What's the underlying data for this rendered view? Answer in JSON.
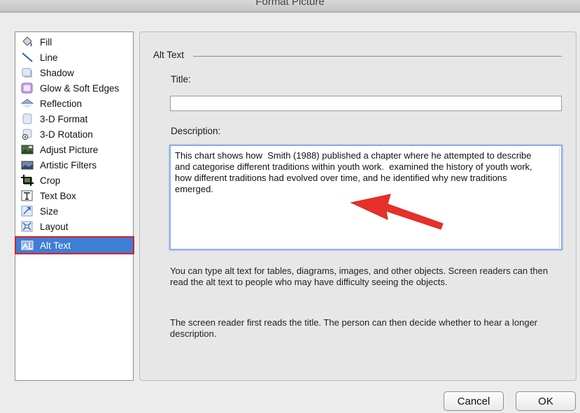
{
  "window": {
    "title": "Format Picture"
  },
  "sidebar": {
    "items": [
      {
        "label": "Fill",
        "icon": "paint-bucket-icon"
      },
      {
        "label": "Line",
        "icon": "line-icon"
      },
      {
        "label": "Shadow",
        "icon": "shadow-icon"
      },
      {
        "label": "Glow & Soft Edges",
        "icon": "glow-icon"
      },
      {
        "label": "Reflection",
        "icon": "reflection-icon"
      },
      {
        "label": "3-D Format",
        "icon": "3d-format-icon"
      },
      {
        "label": "3-D Rotation",
        "icon": "3d-rotation-icon"
      },
      {
        "label": "Adjust Picture",
        "icon": "adjust-picture-icon"
      },
      {
        "label": "Artistic Filters",
        "icon": "artistic-filters-icon"
      },
      {
        "label": "Crop",
        "icon": "crop-icon"
      },
      {
        "label": "Text Box",
        "icon": "text-box-icon"
      },
      {
        "label": "Size",
        "icon": "size-icon"
      },
      {
        "label": "Layout",
        "icon": "layout-icon"
      },
      {
        "label": "Alt Text",
        "icon": "alt-text-icon",
        "selected": true
      }
    ]
  },
  "panel": {
    "section_title": "Alt Text",
    "title_label": "Title:",
    "title_value": "",
    "description_label": "Description:",
    "description_value": "This chart shows how  Smith (1988) published a chapter where he attempted to describe and categorise different traditions within youth work.  examined the history of youth work, how different traditions had evolved over time, and he identified why new traditions emerged.",
    "help_text_1": "You can type alt text for tables, diagrams, images, and other objects. Screen readers can then read the alt text to people who may have difficulty seeing the objects.",
    "help_text_2": "The screen reader first reads the title. The person can then decide whether to hear a longer description."
  },
  "buttons": {
    "cancel": "Cancel",
    "ok": "OK"
  },
  "colors": {
    "selection": "#3d7ed6",
    "highlight_outline": "#e01e1e",
    "arrow": "#e8302a"
  }
}
